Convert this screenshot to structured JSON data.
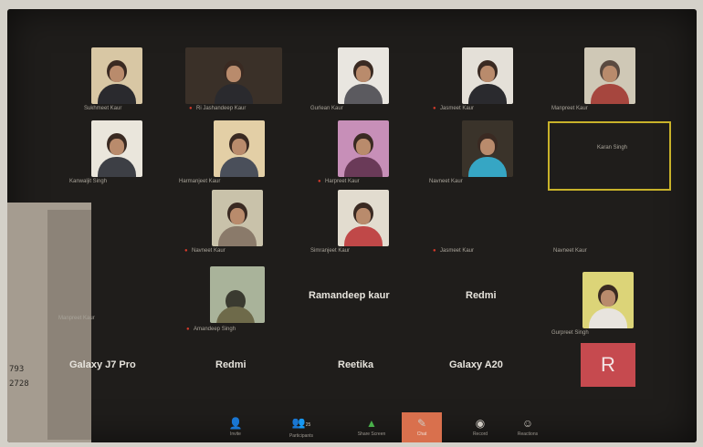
{
  "participants": [
    {
      "name": "Sukhmeet Kaur"
    },
    {
      "name": "Ri Jashandeep Kaur"
    },
    {
      "name": "Gurlean Kaur"
    },
    {
      "name": "Jasmeet Kaur"
    },
    {
      "name": "Manpreet Kaur"
    },
    {
      "name": "Kanwaljit Singh"
    },
    {
      "name": "Harmanjeet Kaur"
    },
    {
      "name": "Harpreet Kaur"
    },
    {
      "name": "Navneet Kaur"
    },
    {
      "name": "Karan Singh"
    },
    {
      "name": "Navneet Kaur"
    },
    {
      "name": "Simranjeet Kaur"
    },
    {
      "name": "Jasmeet Kaur"
    },
    {
      "name": "Navneet Kaur"
    },
    {
      "name": "Manpreet Kaur"
    },
    {
      "name": "Amandeep Singh"
    },
    {
      "name": "Gurpreet Singh"
    }
  ],
  "big_labels": [
    "Ramandeep kaur",
    "Redmi",
    "Galaxy J7 Pro",
    "Redmi",
    "Reetika",
    "Galaxy A20"
  ],
  "avatar_letter": "R",
  "strip_text": [
    "793",
    "2728"
  ],
  "toolbar": [
    {
      "label": "Invite",
      "icon": "invite-icon"
    },
    {
      "label": "Participants",
      "icon": "participants-icon",
      "count": "25"
    },
    {
      "label": "Share Screen",
      "icon": "share-screen-icon"
    },
    {
      "label": "Chat",
      "icon": "chat-icon"
    },
    {
      "label": "Record",
      "icon": "record-icon"
    },
    {
      "label": "Reactions",
      "icon": "reactions-icon"
    }
  ],
  "colors": {
    "highlight": "#c8b22a",
    "chat_active": "#d9704d",
    "avatar_bg": "#c64a4f"
  }
}
